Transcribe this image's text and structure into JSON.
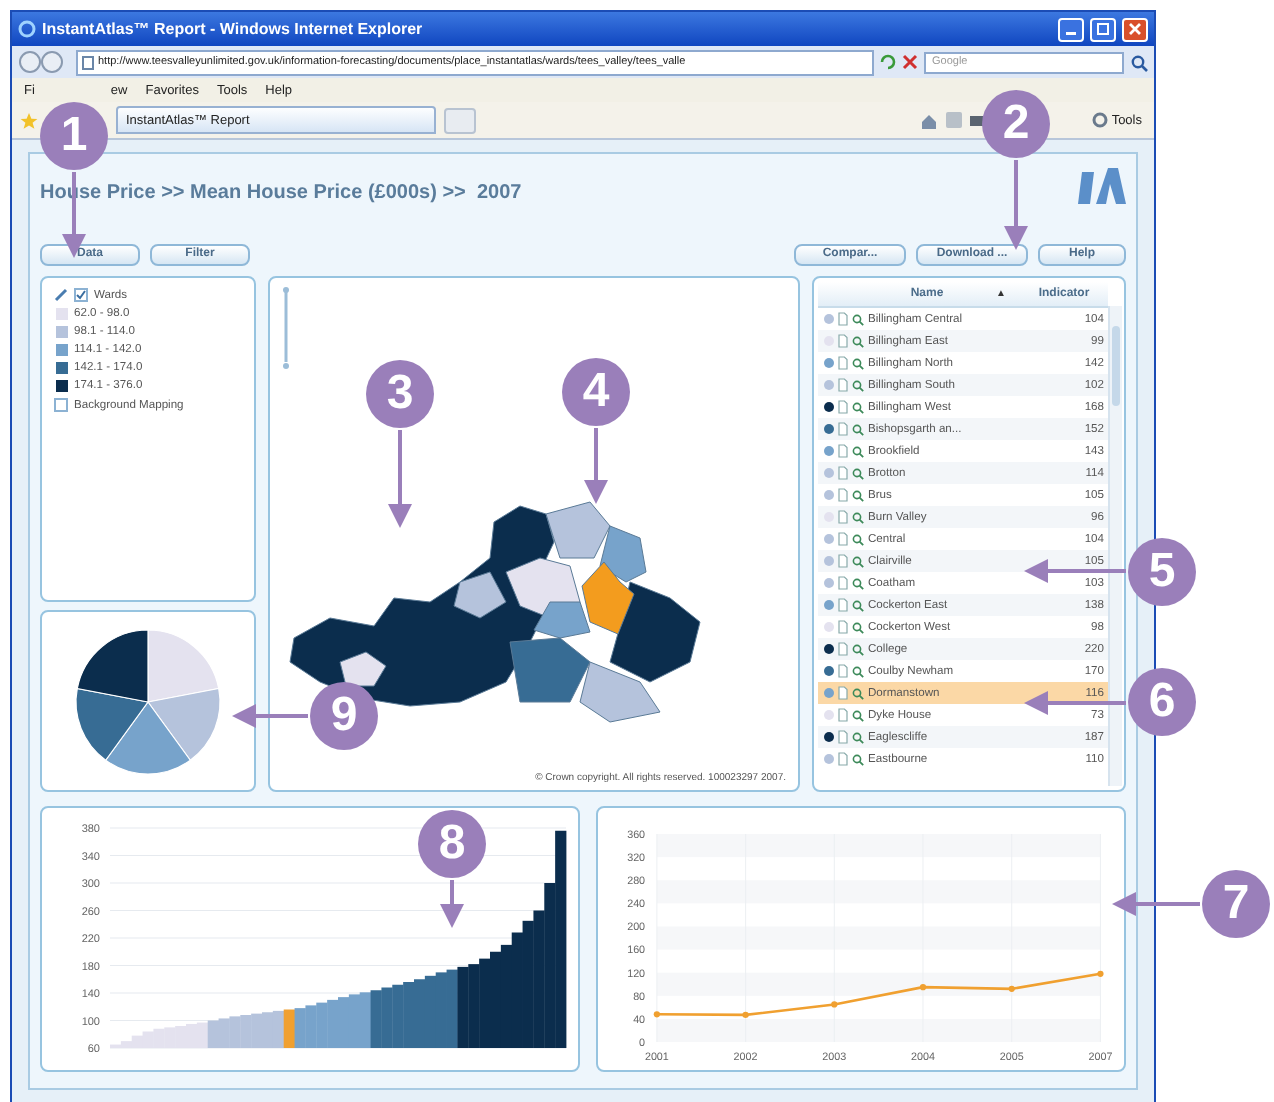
{
  "window": {
    "title": "InstantAtlas™ Report - Windows Internet Explorer"
  },
  "address_bar": {
    "url": "http://www.teesvalleyunlimited.gov.uk/information-forecasting/documents/place_instantatlas/wards/tees_valley/tees_valle",
    "search_placeholder": "Google"
  },
  "menu": [
    "Fi",
    "ew",
    "Favorites",
    "Tools",
    "Help"
  ],
  "tab": {
    "label": "InstantAtlas™ Report"
  },
  "toolbar": {
    "tools_label": "Tools"
  },
  "report": {
    "title": "House Price >> Mean House Price (£000s) >>  2007",
    "left_buttons": [
      "Data",
      "Filter"
    ],
    "right_buttons": [
      "Compar...",
      "Download ...",
      "Help"
    ]
  },
  "legend": {
    "layer": {
      "label": "Wards",
      "checked": true
    },
    "classes": [
      {
        "label": "62.0 - 98.0",
        "color": "#e4e2ef"
      },
      {
        "label": "98.1 - 114.0",
        "color": "#b5c3dc"
      },
      {
        "label": "114.1 - 142.0",
        "color": "#77a3cb"
      },
      {
        "label": "142.1 - 174.0",
        "color": "#376c94"
      },
      {
        "label": "174.1 - 376.0",
        "color": "#0b2d4d"
      }
    ],
    "background": {
      "label": "Background Mapping",
      "checked": false
    }
  },
  "map": {
    "copyright": "© Crown copyright. All rights reserved. 100023297 2007."
  },
  "table": {
    "columns": [
      "Name",
      "Indicator"
    ],
    "sort_indicator": "▲",
    "rows": [
      {
        "name": "Billingham Central",
        "value": "104",
        "color": "#b5c3dc",
        "selected": false
      },
      {
        "name": "Billingham East",
        "value": "99",
        "color": "#e4e2ef",
        "selected": false
      },
      {
        "name": "Billingham North",
        "value": "142",
        "color": "#77a3cb",
        "selected": false
      },
      {
        "name": "Billingham South",
        "value": "102",
        "color": "#b5c3dc",
        "selected": false
      },
      {
        "name": "Billingham West",
        "value": "168",
        "color": "#0b2d4d",
        "selected": false
      },
      {
        "name": "Bishopsgarth an...",
        "value": "152",
        "color": "#376c94",
        "selected": false
      },
      {
        "name": "Brookfield",
        "value": "143",
        "color": "#77a3cb",
        "selected": false
      },
      {
        "name": "Brotton",
        "value": "114",
        "color": "#b5c3dc",
        "selected": false
      },
      {
        "name": "Brus",
        "value": "105",
        "color": "#b5c3dc",
        "selected": false
      },
      {
        "name": "Burn Valley",
        "value": "96",
        "color": "#e4e2ef",
        "selected": false
      },
      {
        "name": "Central",
        "value": "104",
        "color": "#b5c3dc",
        "selected": false
      },
      {
        "name": "Clairville",
        "value": "105",
        "color": "#b5c3dc",
        "selected": false
      },
      {
        "name": "Coatham",
        "value": "103",
        "color": "#b5c3dc",
        "selected": false
      },
      {
        "name": "Cockerton East",
        "value": "138",
        "color": "#77a3cb",
        "selected": false
      },
      {
        "name": "Cockerton West",
        "value": "98",
        "color": "#e4e2ef",
        "selected": false
      },
      {
        "name": "College",
        "value": "220",
        "color": "#0b2d4d",
        "selected": false
      },
      {
        "name": "Coulby Newham",
        "value": "170",
        "color": "#376c94",
        "selected": false
      },
      {
        "name": "Dormanstown",
        "value": "116",
        "color": "#77a3cb",
        "selected": true
      },
      {
        "name": "Dyke House",
        "value": "73",
        "color": "#e4e2ef",
        "selected": false
      },
      {
        "name": "Eaglescliffe",
        "value": "187",
        "color": "#0b2d4d",
        "selected": false
      },
      {
        "name": "Eastbourne",
        "value": "110",
        "color": "#b5c3dc",
        "selected": false
      }
    ]
  },
  "bar_chart": {
    "chart_data": {
      "type": "bar",
      "ylim": [
        60,
        380
      ],
      "yticks": [
        60,
        100,
        140,
        180,
        220,
        260,
        300,
        340,
        380
      ],
      "series": [
        {
          "color": "#e4e2ef",
          "values": [
            65,
            70,
            78,
            84,
            88,
            90,
            92,
            95,
            97,
            null,
            null,
            null,
            null,
            null,
            null,
            null,
            null,
            null,
            null,
            null,
            null,
            null,
            null,
            null,
            null,
            null,
            null,
            null,
            null,
            null,
            null,
            null,
            null,
            null,
            null,
            null,
            null,
            null,
            null,
            null,
            null,
            null
          ]
        },
        {
          "color": "#b5c3dc",
          "values": [
            null,
            null,
            null,
            null,
            null,
            null,
            null,
            null,
            null,
            100,
            103,
            106,
            108,
            110,
            112,
            114,
            null,
            null,
            null,
            null,
            null,
            null,
            null,
            null,
            null,
            null,
            null,
            null,
            null,
            null,
            null,
            null,
            null,
            null,
            null,
            null,
            null,
            null,
            null,
            null,
            null,
            null
          ]
        },
        {
          "color": "#f0a030",
          "values": [
            null,
            null,
            null,
            null,
            null,
            null,
            null,
            null,
            null,
            null,
            null,
            null,
            null,
            null,
            null,
            null,
            116,
            null,
            null,
            null,
            null,
            null,
            null,
            null,
            null,
            null,
            null,
            null,
            null,
            null,
            null,
            null,
            null,
            null,
            null,
            null,
            null,
            null,
            null,
            null,
            null,
            null
          ]
        },
        {
          "color": "#77a3cb",
          "values": [
            null,
            null,
            null,
            null,
            null,
            null,
            null,
            null,
            null,
            null,
            null,
            null,
            null,
            null,
            null,
            null,
            null,
            118,
            122,
            126,
            130,
            134,
            138,
            141,
            null,
            null,
            null,
            null,
            null,
            null,
            null,
            null,
            null,
            null,
            null,
            null,
            null,
            null,
            null,
            null,
            null,
            null
          ]
        },
        {
          "color": "#376c94",
          "values": [
            null,
            null,
            null,
            null,
            null,
            null,
            null,
            null,
            null,
            null,
            null,
            null,
            null,
            null,
            null,
            null,
            null,
            null,
            null,
            null,
            null,
            null,
            null,
            null,
            144,
            148,
            152,
            156,
            160,
            165,
            170,
            174,
            null,
            null,
            null,
            null,
            null,
            null,
            null,
            null,
            null,
            null
          ]
        },
        {
          "color": "#0b2d4d",
          "values": [
            null,
            null,
            null,
            null,
            null,
            null,
            null,
            null,
            null,
            null,
            null,
            null,
            null,
            null,
            null,
            null,
            null,
            null,
            null,
            null,
            null,
            null,
            null,
            null,
            null,
            null,
            null,
            null,
            null,
            null,
            null,
            null,
            178,
            182,
            190,
            200,
            210,
            228,
            245,
            260,
            300,
            376
          ]
        }
      ],
      "grid": true
    }
  },
  "line_chart": {
    "chart_data": {
      "type": "line",
      "categories": [
        "2001",
        "2002",
        "2003",
        "2004",
        "2005",
        "2007"
      ],
      "ylim": [
        0,
        360
      ],
      "yticks": [
        0,
        40,
        80,
        120,
        160,
        200,
        240,
        280,
        320,
        360
      ],
      "grid": true,
      "series": [
        {
          "color": "#f0a030",
          "marker": "circle",
          "values": [
            48,
            47,
            65,
            95,
            92,
            118
          ]
        }
      ]
    }
  },
  "callouts": [
    "1",
    "2",
    "3",
    "4",
    "5",
    "6",
    "7",
    "8",
    "9"
  ]
}
